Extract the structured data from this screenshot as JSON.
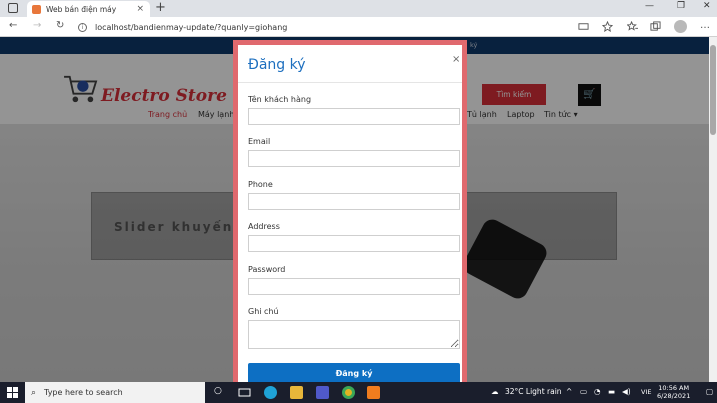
{
  "browser": {
    "tab_title": "Web bán điện máy",
    "tab_close": "×",
    "new_tab": "+",
    "url": "localhost/bandienmay-update/?quanly=giohang",
    "window_controls": [
      "—",
      "❐",
      "✕"
    ]
  },
  "site": {
    "topbar_text": "ký",
    "logo_text": "Electro Store",
    "search_button": "Tìm kiếm",
    "menu": [
      "Trang chủ",
      "Máy lạnh",
      "Tủ lạnh",
      "Laptop",
      "Tin tức"
    ],
    "slider_text": "Slider khuyến m"
  },
  "modal": {
    "title": "Đăng ký",
    "close": "×",
    "fields": [
      {
        "label": "Tên khách hàng"
      },
      {
        "label": "Email"
      },
      {
        "label": "Phone"
      },
      {
        "label": "Address"
      },
      {
        "label": "Password"
      },
      {
        "label": "Ghi chú"
      }
    ],
    "submit_label": "Đăng ký"
  },
  "taskbar": {
    "search_placeholder": "Type here to search",
    "weather": "32°C  Light rain",
    "language": "VIE",
    "time": "10:56 AM",
    "date": "6/28/2021"
  },
  "colors": {
    "accent_red": "#d9303a",
    "modal_blue": "#1d6fbf",
    "button_blue": "#0d6fc3",
    "topbar_navy": "#0f3a6c"
  }
}
